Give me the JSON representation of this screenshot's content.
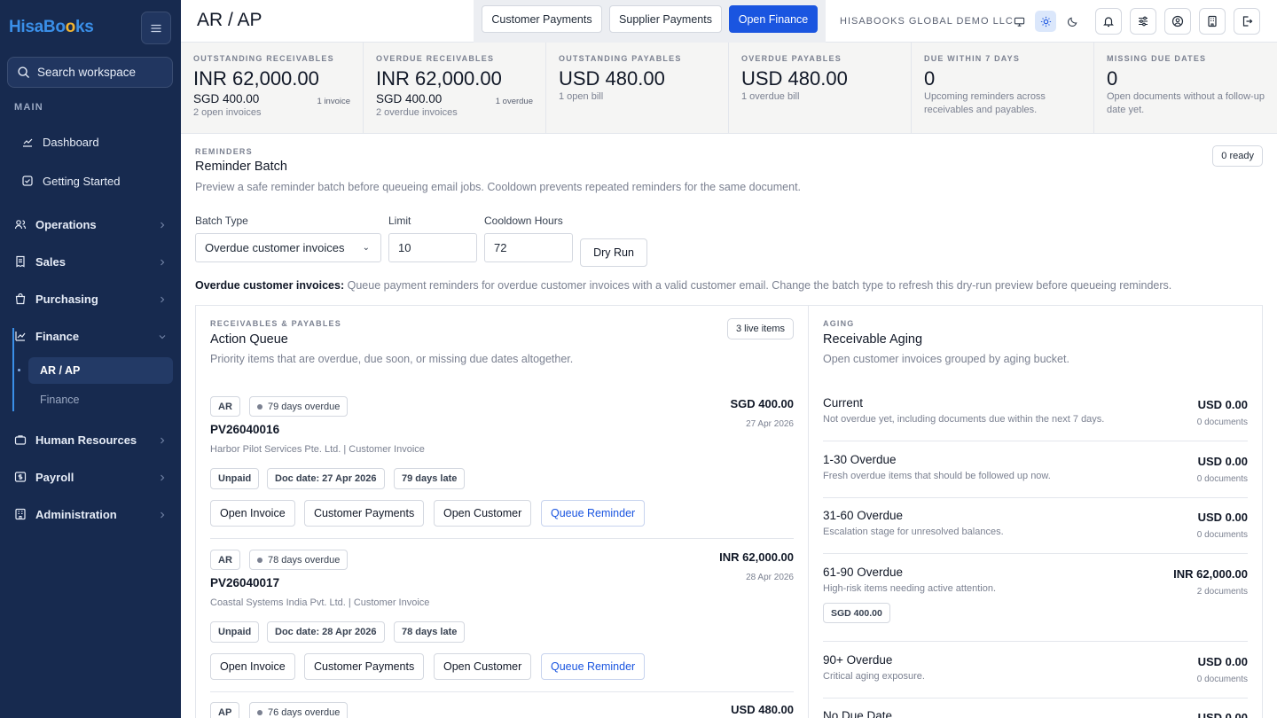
{
  "sidebar": {
    "logo_main": "HisaBo",
    "logo_accent": "o",
    "logo_end": "ks",
    "search_placeholder": "Search workspace",
    "section_label": "MAIN",
    "items": {
      "dashboard": "Dashboard",
      "getting_started": "Getting Started",
      "operations": "Operations",
      "sales": "Sales",
      "purchasing": "Purchasing",
      "finance": "Finance",
      "ar_ap": "AR / AP",
      "finance_sub": "Finance",
      "human_resources": "Human Resources",
      "payroll": "Payroll",
      "administration": "Administration"
    }
  },
  "header": {
    "title": "AR / AP",
    "buttons": {
      "customer_payments": "Customer Payments",
      "supplier_payments": "Supplier Payments",
      "open_finance": "Open Finance"
    },
    "company": "HISABOOKS GLOBAL DEMO LLC",
    "theme_mode": "light"
  },
  "kpis": [
    {
      "label": "OUTSTANDING RECEIVABLES",
      "value": "INR 62,000.00",
      "sub": "SGD 400.00",
      "count": "1 invoice",
      "note": "2 open invoices"
    },
    {
      "label": "OVERDUE RECEIVABLES",
      "value": "INR 62,000.00",
      "sub": "SGD 400.00",
      "count": "1 overdue",
      "note": "2 overdue invoices"
    },
    {
      "label": "OUTSTANDING PAYABLES",
      "value": "USD 480.00",
      "note": "1 open bill"
    },
    {
      "label": "OVERDUE PAYABLES",
      "value": "USD 480.00",
      "note": "1 overdue bill"
    },
    {
      "label": "DUE WITHIN 7 DAYS",
      "value": "0",
      "note": "Upcoming reminders across receivables and payables."
    },
    {
      "label": "MISSING DUE DATES",
      "value": "0",
      "note": "Open documents without a follow-up date yet."
    }
  ],
  "reminders": {
    "eyebrow": "REMINDERS",
    "title": "Reminder Batch",
    "description": "Preview a safe reminder batch before queueing email jobs. Cooldown prevents repeated reminders for the same document.",
    "ready_badge": "0 ready",
    "batch_type_label": "Batch Type",
    "batch_type_value": "Overdue customer invoices",
    "limit_label": "Limit",
    "limit_value": "10",
    "cooldown_label": "Cooldown Hours",
    "cooldown_value": "72",
    "dry_run_label": "Dry Run",
    "info_title": "Overdue customer invoices:",
    "info_text": "Queue payment reminders for overdue customer invoices with a valid customer email. Change the batch type to refresh this dry-run preview before queueing reminders."
  },
  "action_queue": {
    "eyebrow": "RECEIVABLES & PAYABLES",
    "title": "Action Queue",
    "description": "Priority items that are overdue, due soon, or missing due dates altogether.",
    "live_badge": "3 live items",
    "items": [
      {
        "type": "AR",
        "status": "79 days overdue",
        "amount": "SGD 400.00",
        "date": "27 Apr 2026",
        "doc": "PV26040016",
        "party": "Harbor Pilot Services Pte. Ltd. | Customer Invoice",
        "chips": [
          "Unpaid",
          "Doc date: 27 Apr 2026",
          "79 days late"
        ],
        "actions": [
          "Open Invoice",
          "Customer Payments",
          "Open Customer",
          "Queue Reminder"
        ]
      },
      {
        "type": "AR",
        "status": "78 days overdue",
        "amount": "INR 62,000.00",
        "date": "28 Apr 2026",
        "doc": "PV26040017",
        "party": "Coastal Systems India Pvt. Ltd. | Customer Invoice",
        "chips": [
          "Unpaid",
          "Doc date: 28 Apr 2026",
          "78 days late"
        ],
        "actions": [
          "Open Invoice",
          "Customer Payments",
          "Open Customer",
          "Queue Reminder"
        ]
      },
      {
        "type": "AP",
        "status": "76 days overdue",
        "amount": "USD 480.00"
      }
    ]
  },
  "aging": {
    "eyebrow": "AGING",
    "title": "Receivable Aging",
    "description": "Open customer invoices grouped by aging bucket.",
    "buckets": [
      {
        "title": "Current",
        "desc": "Not overdue yet, including documents due within the next 7 days.",
        "amount": "USD 0.00",
        "count": "0 documents"
      },
      {
        "title": "1-30 Overdue",
        "desc": "Fresh overdue items that should be followed up now.",
        "amount": "USD 0.00",
        "count": "0 documents"
      },
      {
        "title": "31-60 Overdue",
        "desc": "Escalation stage for unresolved balances.",
        "amount": "USD 0.00",
        "count": "0 documents"
      },
      {
        "title": "61-90 Overdue",
        "desc": "High-risk items needing active attention.",
        "amount": "INR 62,000.00",
        "count": "2 documents",
        "extra": "SGD 400.00"
      },
      {
        "title": "90+ Overdue",
        "desc": "Critical aging exposure.",
        "amount": "USD 0.00",
        "count": "0 documents"
      },
      {
        "title": "No Due Date",
        "amount": "USD 0.00"
      }
    ]
  }
}
